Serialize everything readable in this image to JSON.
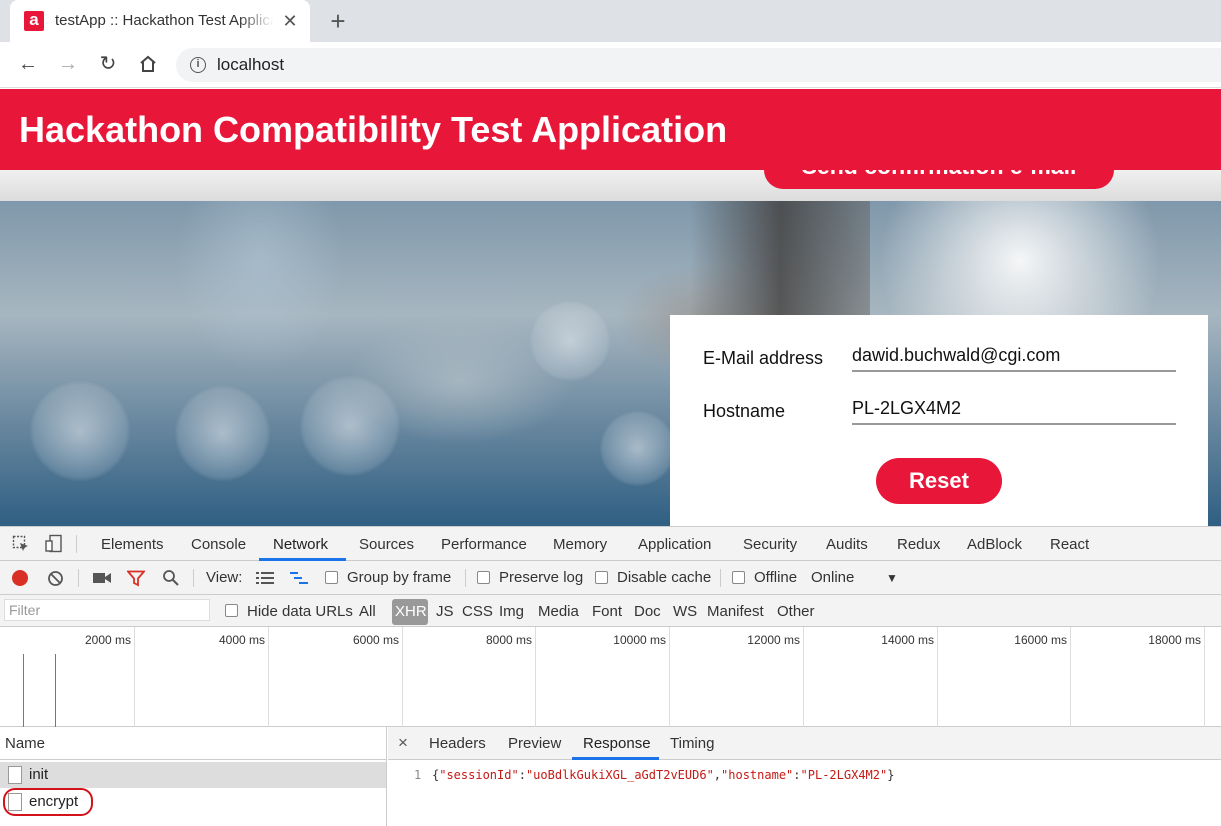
{
  "browser": {
    "tab_title": "testApp :: Hackathon Test Application",
    "favicon_letter": "a",
    "tab_close": "✕",
    "new_tab": "+",
    "url": "localhost"
  },
  "app": {
    "header_title": "Hackathon Compatibility Test Application",
    "confirm_button": "Send confirmation e-mail",
    "form": {
      "email_label": "E-Mail address",
      "email_value": "dawid.buchwald@cgi.com",
      "hostname_label": "Hostname",
      "hostname_value": "PL-2LGX4M2",
      "reset_button": "Reset"
    },
    "brand_color": "#e8173a"
  },
  "devtools": {
    "tabs": [
      "Elements",
      "Console",
      "Network",
      "Sources",
      "Performance",
      "Memory",
      "Application",
      "Security",
      "Audits",
      "Redux",
      "AdBlock",
      "React"
    ],
    "active_tab": "Network",
    "toolbar": {
      "view_label": "View:",
      "group_by_frame": "Group by frame",
      "preserve_log": "Preserve log",
      "disable_cache": "Disable cache",
      "offline": "Offline",
      "throttling": "Online"
    },
    "filter": {
      "placeholder": "Filter",
      "hide_data_urls": "Hide data URLs",
      "types": [
        "All",
        "XHR",
        "JS",
        "CSS",
        "Img",
        "Media",
        "Font",
        "Doc",
        "WS",
        "Manifest",
        "Other"
      ],
      "active_type": "XHR"
    },
    "timeline_ticks": [
      "2000 ms",
      "4000 ms",
      "6000 ms",
      "8000 ms",
      "10000 ms",
      "12000 ms",
      "14000 ms",
      "16000 ms",
      "18000 ms"
    ],
    "requests": {
      "header": "Name",
      "items": [
        "init",
        "encrypt"
      ],
      "selected": "init"
    },
    "detail": {
      "close": "×",
      "tabs": [
        "Headers",
        "Preview",
        "Response",
        "Timing"
      ],
      "active_tab": "Response",
      "line_number": "1",
      "response": {
        "open": "{",
        "k1": "\"sessionId\"",
        "colon1": ":",
        "v1": "\"uoBdlkGukiXGL_aGdT2vEUD6\"",
        "comma": ",",
        "k2": "\"hostname\"",
        "colon2": ":",
        "v2": "\"PL-2LGX4M2\"",
        "close": "}"
      }
    }
  }
}
